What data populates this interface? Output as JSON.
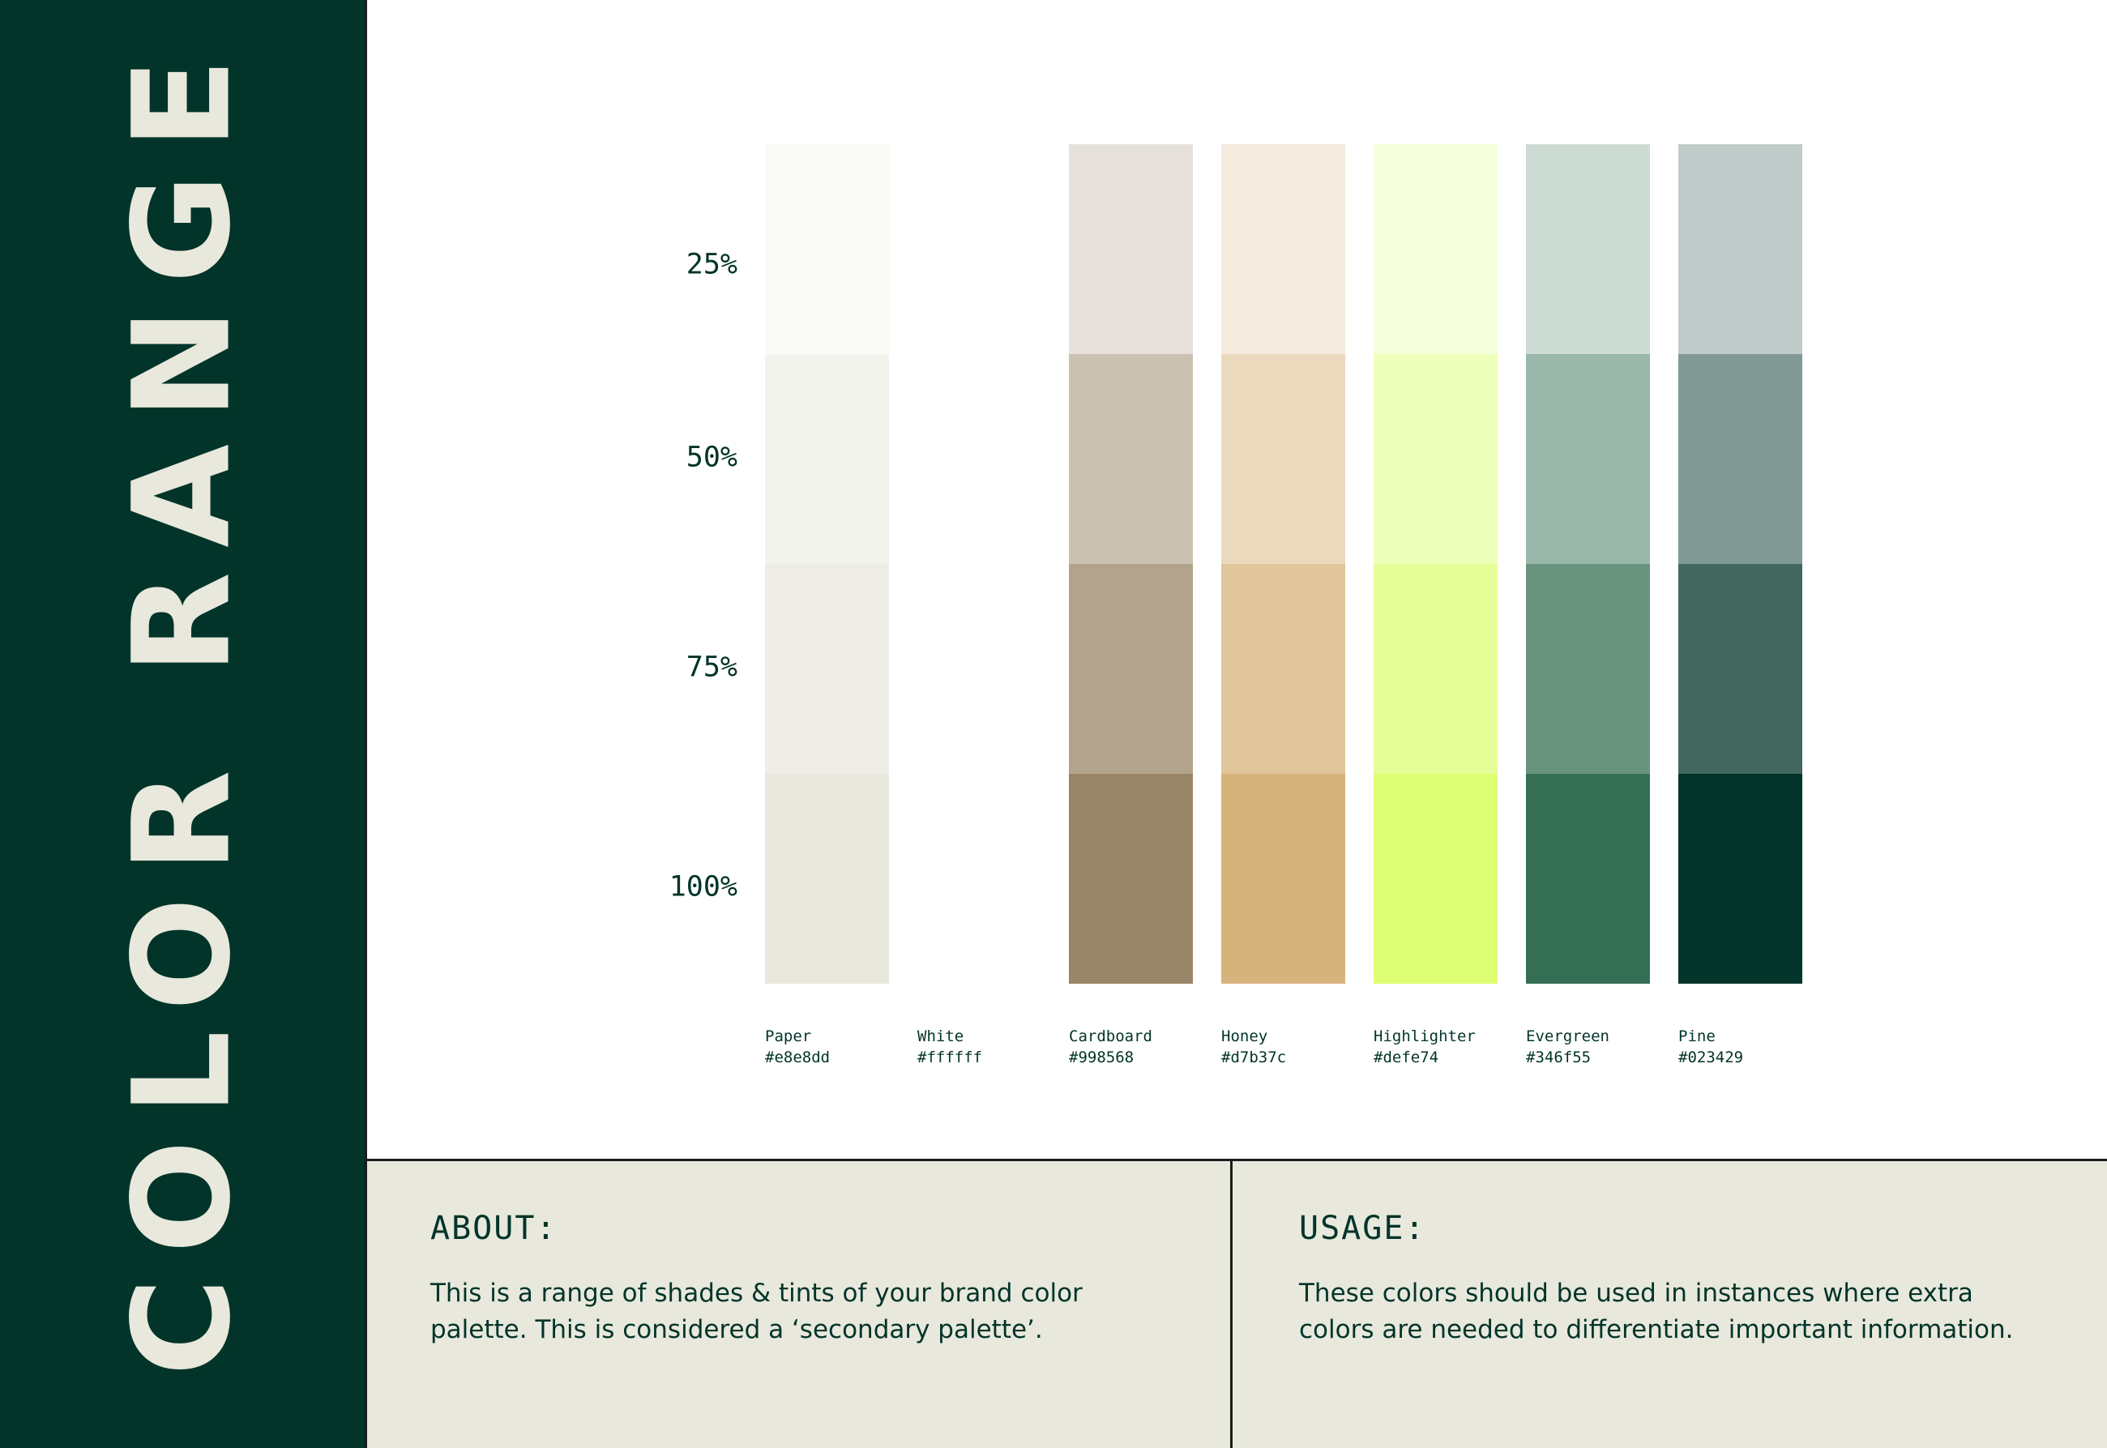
{
  "theme": {
    "sidebar_bg": "#023429",
    "title_color": "#e8e8dd",
    "text_color": "#023429",
    "panel_bg": "#e8e8dd",
    "line_color": "#1c1c1c",
    "page_bg": "#ffffff"
  },
  "sidebar": {
    "title": "COLOR RANGE"
  },
  "scale": {
    "labels": [
      "25%",
      "50%",
      "75%",
      "100%"
    ]
  },
  "palette": [
    {
      "name": "Paper",
      "hex": "#e8e8dd",
      "shades": [
        "#f9f9f6",
        "#f3f3ee",
        "#eeeee6",
        "#e8e8dd"
      ]
    },
    {
      "name": "White",
      "hex": "#ffffff",
      "shades": [
        "#ffffff",
        "#ffffff",
        "#ffffff",
        "#ffffff"
      ]
    },
    {
      "name": "Cardboard",
      "hex": "#998568",
      "shades": [
        "#e5e0da",
        "#cbc1b2",
        "#b2a38c",
        "#998568"
      ]
    },
    {
      "name": "Honey",
      "hex": "#d7b37c",
      "shades": [
        "#f4ebde",
        "#ebd9bd",
        "#e1c69c",
        "#d7b37c"
      ]
    },
    {
      "name": "Highlighter",
      "hex": "#defe74",
      "shades": [
        "#f5ffdc",
        "#eeffb9",
        "#e6fe97",
        "#defe74"
      ]
    },
    {
      "name": "Evergreen",
      "hex": "#346f55",
      "shades": [
        "#ccdbd4",
        "#99b7aa",
        "#67937f",
        "#346f55"
      ]
    },
    {
      "name": "Pine",
      "hex": "#023429",
      "shades": [
        "#c0ccc9",
        "#809994",
        "#41675e",
        "#023429"
      ]
    }
  ],
  "palette_hex_labels": [
    "#e8e8dd",
    "#ffffff",
    "#998568",
    "#d7b37c",
    "#defe74",
    "#346f55",
    "#023429"
  ],
  "about": {
    "heading": "ABOUT:",
    "line1": "This is a range of shades & tints of your brand color",
    "line2": "palette. This is considered a ‘secondary palette’."
  },
  "usage": {
    "heading": "USAGE:",
    "line1": "These colors should be used in instances where extra",
    "line2": "colors are needed to differentiate important information."
  }
}
